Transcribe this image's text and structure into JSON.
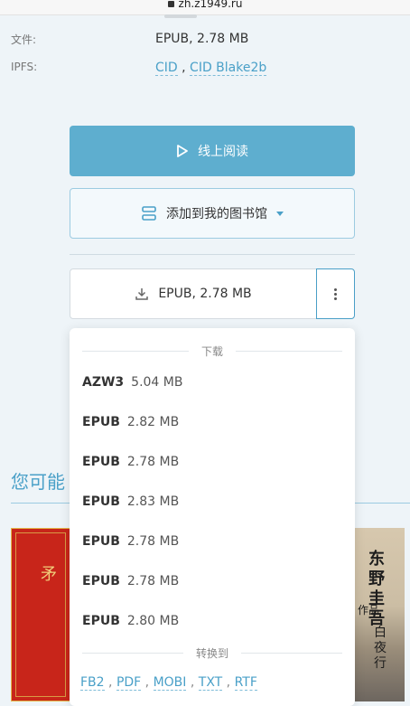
{
  "browser": {
    "url": "zh.z1949.ru"
  },
  "meta": [
    {
      "label": "文件:",
      "value": "EPUB, 2.78 MB"
    },
    {
      "label": "IPFS:",
      "links": [
        "CID",
        "CID Blake2b"
      ],
      "separator": " , "
    }
  ],
  "actions": {
    "read_label": "线上阅读",
    "add_label": "添加到我的图书馆",
    "download_label": "EPUB, 2.78 MB"
  },
  "dropdown": {
    "download_header": "下载",
    "items": [
      {
        "format": "AZW3",
        "size": "5.04 MB"
      },
      {
        "format": "EPUB",
        "size": "2.82 MB"
      },
      {
        "format": "EPUB",
        "size": "2.78 MB"
      },
      {
        "format": "EPUB",
        "size": "2.83 MB"
      },
      {
        "format": "EPUB",
        "size": "2.78 MB"
      },
      {
        "format": "EPUB",
        "size": "2.78 MB"
      },
      {
        "format": "EPUB",
        "size": "2.80 MB"
      }
    ],
    "convert_header": "转换到",
    "convert_formats": [
      "FB2",
      "PDF",
      "MOBI",
      "TXT",
      "RTF"
    ]
  },
  "section": {
    "heading": "您可能"
  },
  "books": {
    "left_cover_text": "矛",
    "right_cover_text": [
      "东野圭吾",
      "作品",
      "白夜行"
    ]
  },
  "colors": {
    "accent": "#5eaecf",
    "link": "#4aa0c8",
    "background": "#eef4f8"
  }
}
